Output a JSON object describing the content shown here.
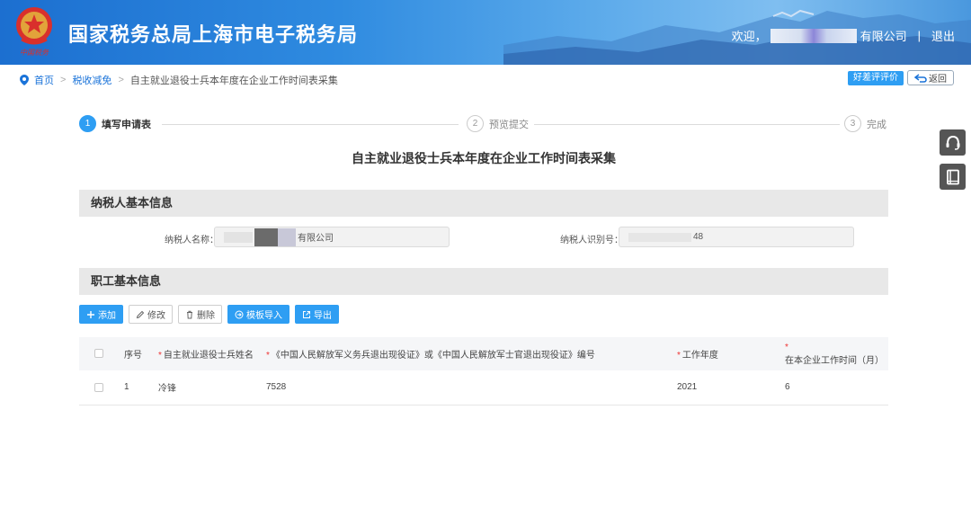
{
  "header": {
    "site_title": "国家税务总局上海市电子税务局",
    "welcome_prefix": "欢迎，",
    "company_suffix": "有限公司",
    "separator": "|",
    "logout": "退出",
    "logo_caption": "中国税务"
  },
  "breadcrumb": {
    "home": "首页",
    "level2": "税收减免",
    "current": "自主就业退役士兵本年度在企业工作时间表采集",
    "arrow": ">"
  },
  "actions": {
    "rate": "好差评评价",
    "back": "返回"
  },
  "steps": [
    {
      "num": "1",
      "label": "填写申请表"
    },
    {
      "num": "2",
      "label": "预览提交"
    },
    {
      "num": "3",
      "label": "完成"
    }
  ],
  "form_title": "自主就业退役士兵本年度在企业工作时间表采集",
  "taxpayer_section": {
    "title": "纳税人基本信息",
    "name_label": "纳税人名称：",
    "name_value_suffix": "有限公司",
    "id_label": "纳税人识别号：",
    "id_value_suffix": "48"
  },
  "employee_section": {
    "title": "职工基本信息"
  },
  "toolbar": {
    "add": "添加",
    "edit": "修改",
    "delete": "删除",
    "import": "模板导入",
    "export": "导出"
  },
  "table": {
    "headers": {
      "index": "序号",
      "name": "自主就业退役士兵姓名",
      "cert": "《中国人民解放军义务兵退出现役证》或《中国人民解放军士官退出现役证》编号",
      "year": "工作年度",
      "months": "在本企业工作时间（月）"
    },
    "required_mark": "*",
    "rows": [
      {
        "index": "1",
        "name": "冷锋",
        "cert": "7528",
        "year": "2021",
        "months": "6"
      }
    ]
  },
  "colors": {
    "primary": "#2e9ef3",
    "header_blue": "#1c6fd0",
    "required": "#e33333"
  },
  "icons": [
    "location-pin-icon",
    "back-arrow-icon",
    "headset-icon",
    "book-icon",
    "plus-icon",
    "pencil-icon",
    "trash-icon",
    "import-icon",
    "export-icon"
  ]
}
